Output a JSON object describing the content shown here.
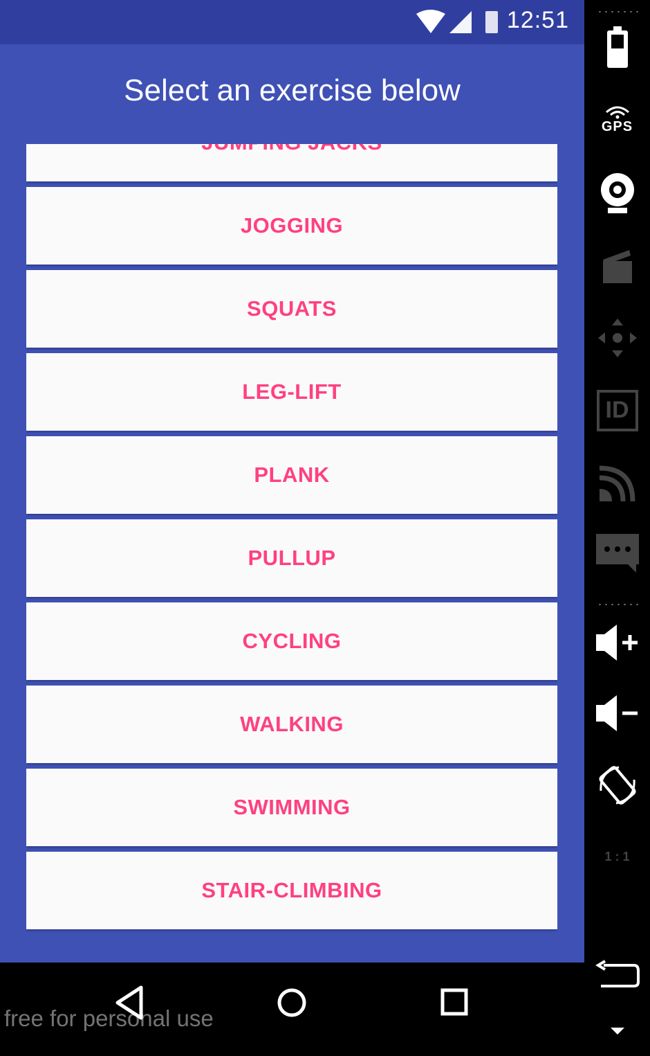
{
  "status_bar": {
    "time": "12:51"
  },
  "header": {
    "title": "Select an exercise below"
  },
  "exercises": [
    "JUMPING JACKS",
    "JOGGING",
    "SQUATS",
    "LEG-LIFT",
    "PLANK",
    "PULLUP",
    "CYCLING",
    "WALKING",
    "SWIMMING",
    "STAIR-CLIMBING"
  ],
  "watermark": "free for personal use",
  "emulator_toolbar": {
    "gps_label": "GPS",
    "id_label": "ID",
    "ratio_label": "1 : 1",
    "tools": [
      "battery-icon",
      "gps-icon",
      "camera-icon",
      "screenrecord-icon",
      "dpad-icon",
      "fingerprint-id-icon",
      "cast-icon",
      "sms-icon",
      "volume-up-icon",
      "volume-down-icon",
      "rotate-icon",
      "zoom-1to1-icon",
      "back-icon",
      "more-icon"
    ]
  },
  "nav_bar": {
    "buttons": [
      "back-icon",
      "home-icon",
      "recents-icon"
    ]
  },
  "colors": {
    "primary": "#3F51B5",
    "primary_dark": "#303F9F",
    "accent": "#FF4081",
    "card": "#FAFAFA"
  }
}
